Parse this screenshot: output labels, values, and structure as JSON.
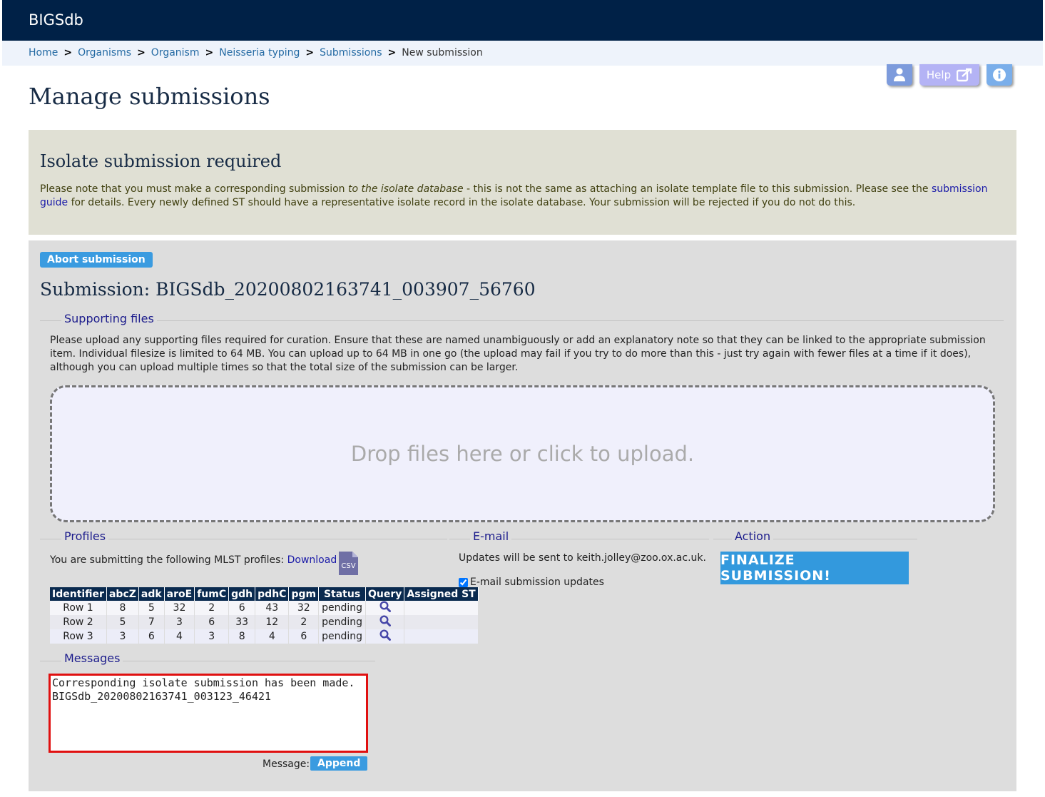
{
  "app": {
    "brand": "BIGSdb"
  },
  "breadcrumbs": [
    {
      "label": "Home"
    },
    {
      "label": "Organisms"
    },
    {
      "label": "Organism"
    },
    {
      "label": "Neisseria typing"
    },
    {
      "label": "Submissions"
    },
    {
      "label": "New submission"
    }
  ],
  "top_icons": {
    "help_label": "Help"
  },
  "page_title": "Manage submissions",
  "notice": {
    "title": "Isolate submission required",
    "text_before": "Please note that you must make a corresponding submission ",
    "text_em": "to the isolate database",
    "text_mid": " - this is not the same as attaching an isolate template file to this submission. Please see the ",
    "link": "submission guide",
    "text_after": " for details. Every newly defined ST should have a representative isolate record in the isolate database. Your submission will be rejected if you do not do this."
  },
  "submission": {
    "abort_label": "Abort submission",
    "title": "Submission: BIGSdb_20200802163741_003907_56760"
  },
  "supporting_files": {
    "legend": "Supporting files",
    "text": "Please upload any supporting files required for curation. Ensure that these are named unambiguously or add an explanatory note so that they can be linked to the appropriate submission item. Individual filesize is limited to 64 MB. You can upload up to 64 MB in one go (the upload may fail if you try to do more than this - just try again with fewer files at a time if it does), although you can upload multiple times so that the total size of the submission can be larger.",
    "dropzone": "Drop files here or click to upload."
  },
  "profiles": {
    "legend": "Profiles",
    "text": "You are submitting the following MLST profiles: ",
    "download": "Download",
    "csv_label": "CSV",
    "columns": [
      "Identifier",
      "abcZ",
      "adk",
      "aroE",
      "fumC",
      "gdh",
      "pdhC",
      "pgm",
      "Status",
      "Query",
      "Assigned ST"
    ],
    "rows": [
      {
        "id": "Row 1",
        "abcZ": "8",
        "adk": "5",
        "aroE": "32",
        "fumC": "2",
        "gdh": "6",
        "pdhC": "43",
        "pgm": "32",
        "status": "pending",
        "st": ""
      },
      {
        "id": "Row 2",
        "abcZ": "5",
        "adk": "7",
        "aroE": "3",
        "fumC": "6",
        "gdh": "33",
        "pdhC": "12",
        "pgm": "2",
        "status": "pending",
        "st": ""
      },
      {
        "id": "Row 3",
        "abcZ": "3",
        "adk": "6",
        "aroE": "4",
        "fumC": "3",
        "gdh": "8",
        "pdhC": "4",
        "pgm": "6",
        "status": "pending",
        "st": ""
      }
    ]
  },
  "email": {
    "legend": "E-mail",
    "text": "Updates will be sent to keith.jolley@zoo.ox.ac.uk.",
    "checkbox_label": "E-mail submission updates",
    "checked": true
  },
  "action": {
    "legend": "Action",
    "finalize_label": "FINALIZE SUBMISSION!"
  },
  "messages": {
    "legend": "Messages",
    "value": "Corresponding isolate submission has been made. BIGSdb_20200802163741_003123_46421",
    "message_label": "Message:",
    "append_label": "Append"
  },
  "colors": {
    "header_bg": "#002147",
    "accent": "#3399dd",
    "highlight_border": "#e01010"
  }
}
